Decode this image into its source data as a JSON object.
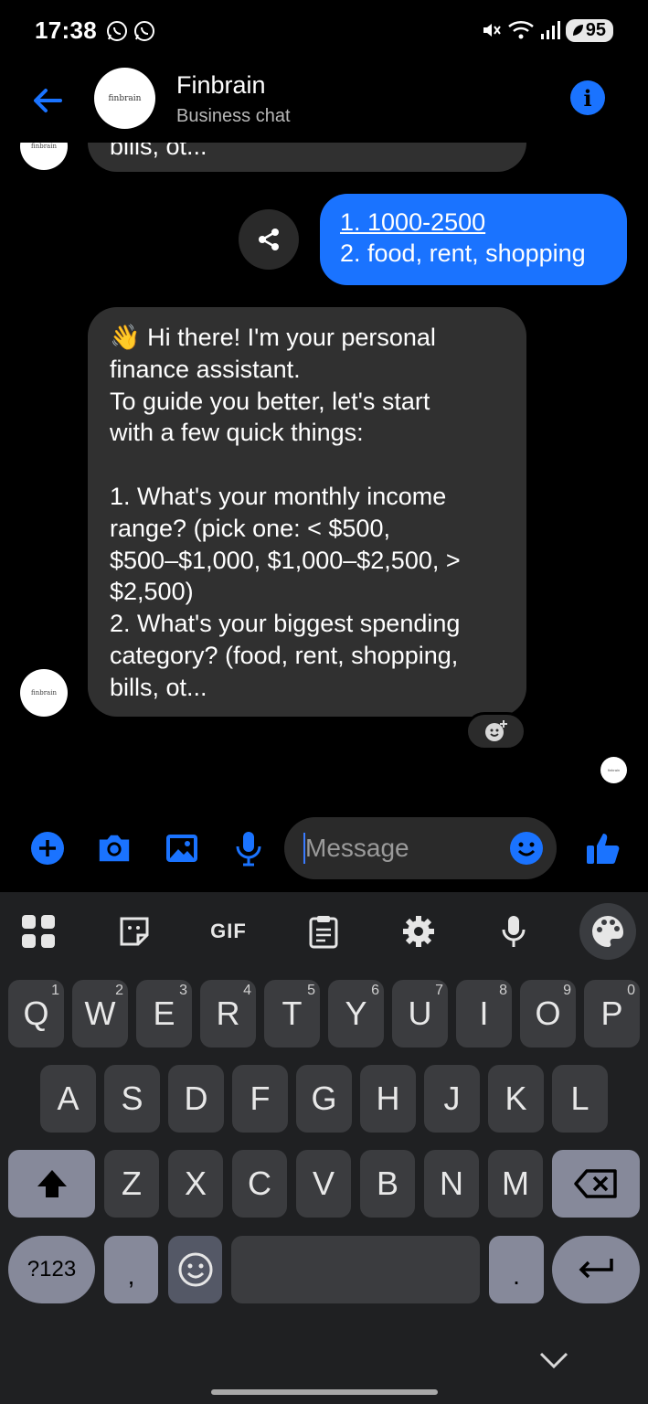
{
  "status_bar": {
    "time": "17:38",
    "notification_icons": [
      "whatsapp-icon",
      "whatsapp-icon"
    ],
    "right_icons": [
      "mute-icon",
      "wifi-icon",
      "signal-icon"
    ],
    "battery": "95"
  },
  "header": {
    "title": "Finbrain",
    "subtitle": "Business chat",
    "avatar_text": "finbrain"
  },
  "chat": {
    "avatar_text": "finbrain",
    "truncated_top_text": "bills, ot...",
    "sent_message": {
      "line1": "1. 1000-2500",
      "line2": "2. food, rent, shopping"
    },
    "received_message": "👋 Hi there! I'm your personal\nfinance assistant.\nTo guide you better, let's start\nwith a few quick things:\n\n1. What's your monthly income\nrange? (pick one: < $500,\n$500–$1,000, $1,000–$2,500, >\n$2,500)\n2. What's your biggest spending\ncategory? (food, rent, shopping,\nbills, ot...",
    "seen_avatar_text": "finbrain"
  },
  "composer": {
    "placeholder": "Message"
  },
  "keyboard": {
    "toolbar": [
      "apps-grid-icon",
      "sticker-icon",
      "GIF",
      "clipboard-icon",
      "settings-icon",
      "mic-icon",
      "palette-icon"
    ],
    "gif_label": "GIF",
    "row1": [
      {
        "k": "Q",
        "h": "1"
      },
      {
        "k": "W",
        "h": "2"
      },
      {
        "k": "E",
        "h": "3"
      },
      {
        "k": "R",
        "h": "4"
      },
      {
        "k": "T",
        "h": "5"
      },
      {
        "k": "Y",
        "h": "6"
      },
      {
        "k": "U",
        "h": "7"
      },
      {
        "k": "I",
        "h": "8"
      },
      {
        "k": "O",
        "h": "9"
      },
      {
        "k": "P",
        "h": "0"
      }
    ],
    "row2": [
      "A",
      "S",
      "D",
      "F",
      "G",
      "H",
      "J",
      "K",
      "L"
    ],
    "row3": [
      "Z",
      "X",
      "C",
      "V",
      "B",
      "N",
      "M"
    ],
    "symbols_label": "?123",
    "comma_label": ",",
    "period_label": "."
  }
}
